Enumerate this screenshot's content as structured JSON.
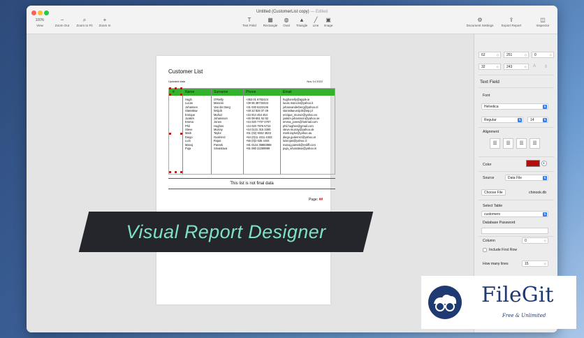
{
  "window": {
    "title": "Untitled (CustomerList copy)",
    "edited": "— Edited"
  },
  "toolbar": {
    "zoom_value": "100%",
    "items": [
      {
        "label": "View",
        "icon": "view"
      },
      {
        "label": "Zoom Out",
        "icon": "minus-icon"
      },
      {
        "label": "Zoom to Fit",
        "icon": "magnifier-icon"
      },
      {
        "label": "Zoom In",
        "icon": "plus-icon"
      },
      {
        "label": "Text Field",
        "icon": "T-icon"
      },
      {
        "label": "Rectangle",
        "icon": "rectangle-icon"
      },
      {
        "label": "Oval",
        "icon": "oval-icon"
      },
      {
        "label": "Triangle",
        "icon": "triangle-icon"
      },
      {
        "label": "Line",
        "icon": "line-icon"
      },
      {
        "label": "Image",
        "icon": "image-icon"
      },
      {
        "label": "Document Settings",
        "icon": "gear-icon"
      },
      {
        "label": "Export Report",
        "icon": "share-icon"
      },
      {
        "label": "Inspector",
        "icon": "sidebar-icon"
      }
    ]
  },
  "report": {
    "title": "Customer List",
    "updated_label": "Updated data",
    "date": "Nov 14 2022",
    "columns": [
      "#",
      "Name",
      "Surname",
      "Phone",
      "Email"
    ],
    "rows": [
      {
        "name": "Hugh",
        "surname": "O'Reilly",
        "phone": "+353 01 6792424",
        "email": "hughoreilly@apple.ie"
      },
      {
        "name": "Lucas",
        "surname": "Mancini",
        "phone": "+39 06 38733434",
        "email": "lucas.mancini@yahoo.it"
      },
      {
        "name": "Johannes",
        "surname": "Van der Berg",
        "phone": "+31 030 6223136",
        "email": "johanvanderberg@yahoo.nl"
      },
      {
        "name": "Stanisław",
        "surname": "Wójcik",
        "phone": "+48 22 828 37 39",
        "email": "stanisław.wójcik@wp.pl"
      },
      {
        "name": "Enrique",
        "surname": "Muñoz",
        "phone": "+34 914 454 454",
        "email": "enrique_munoz@yahoo.es"
      },
      {
        "name": "Joakim",
        "surname": "Johansson",
        "phone": "+46 08-651 52 52",
        "email": "joakim.johansson@yahoo.se"
      },
      {
        "name": "Emma",
        "surname": "Jones",
        "phone": "+44 020 7707 0707",
        "email": "emma_jones@hotmail.com"
      },
      {
        "name": "Phil",
        "surname": "Hughes",
        "phone": "+44 020 7976 5722",
        "email": "phil.hughes@gmail.com"
      },
      {
        "name": "Steve",
        "surname": "Murray",
        "phone": "+44 0131 315 3300",
        "email": "steve.murray@yahoo.uk"
      },
      {
        "name": "Mark",
        "surname": "Taylor",
        "phone": "+61 (02) 9332 3633",
        "email": "mark.taylor@yahoo.au"
      },
      {
        "name": "Diego",
        "surname": "Gutiérrez",
        "phone": "+54 (0)11 4311 4333",
        "email": "diego.gutierrez@yahoo.ar"
      },
      {
        "name": "Luís",
        "surname": "Rojas",
        "phone": "+56 (0)2 635 4444",
        "email": "luisrojas@yahoo.cl"
      },
      {
        "name": "Manoj",
        "surname": "Pareek",
        "phone": "+91 0124 39883988",
        "email": "manoj.pareek@rediff.com"
      },
      {
        "name": "Puja",
        "surname": "Srivastava",
        "phone": "+91 080 22289999",
        "email": "puja_srivastava@yahoo.in"
      }
    ],
    "footer_note": "This list is not final data",
    "page_label": "Page:",
    "page_number": "##"
  },
  "banner": {
    "text": "Visual Report Designer"
  },
  "inspector": {
    "x": "62",
    "y": "251",
    "w": "0",
    "h": "32",
    "d": "243",
    "section_title": "Text Field",
    "font_label": "Font",
    "font_family": "Helvetica",
    "font_style": "Regular",
    "font_size": "14",
    "alignment_label": "Alignment",
    "color_label": "Color",
    "color_value": "#b00d0d",
    "source_label": "Source",
    "source_value": "Data File",
    "choose_file_label": "Choose File",
    "file_name": "chinook.db",
    "select_table_label": "Select Table",
    "table_value": "customers",
    "db_password_label": "Database Password",
    "column_label": "Column",
    "column_value": "0",
    "include_first_row_label": "Include First Row",
    "how_many_lines_label": "How many lines",
    "how_many_lines_value": "15"
  },
  "watermark": {
    "name": "FileGit",
    "tagline": "Free & Unlimited"
  }
}
